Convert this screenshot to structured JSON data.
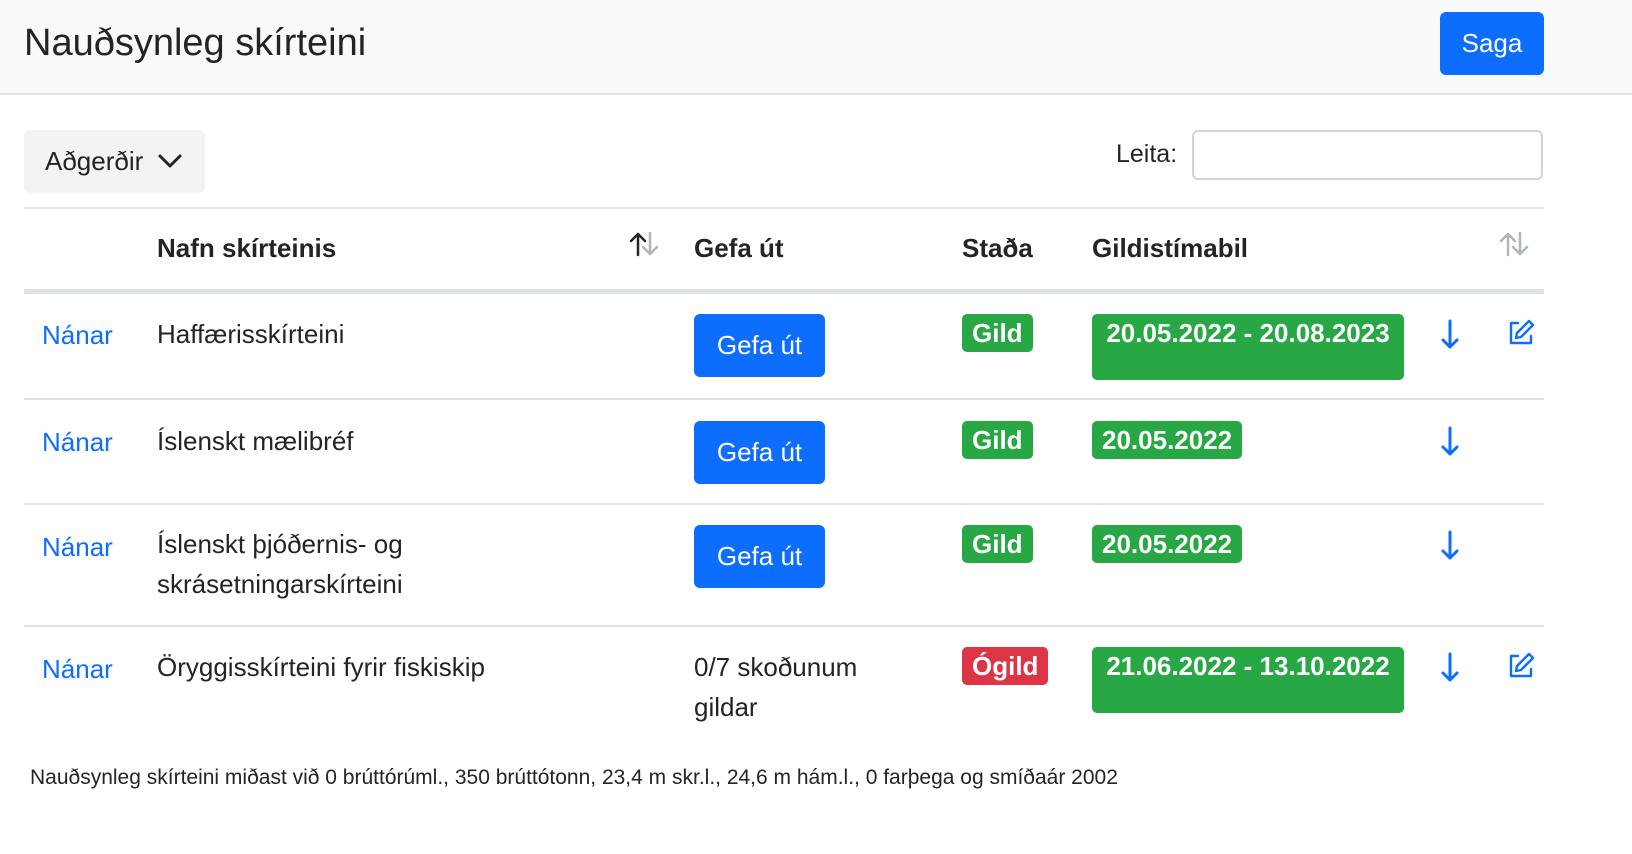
{
  "header": {
    "title": "Nauðsynleg skírteini",
    "history_button": "Saga"
  },
  "toolbar": {
    "actions_label": "Aðgerðir",
    "search_label": "Leita:",
    "search_value": "",
    "search_placeholder": ""
  },
  "table": {
    "columns": [
      "Nafn skírteinis",
      "Gefa út",
      "Staða",
      "Gildistímabil"
    ],
    "rows": [
      {
        "link": "Nánar",
        "name": "Haffærisskírteini",
        "issue_button": "Gefa út",
        "issue_text": "",
        "status": "Gild",
        "status_color": "#28a745",
        "period": "20.05.2022 - 20.08.2023",
        "period_color": "#28a745",
        "has_edit": true
      },
      {
        "link": "Nánar",
        "name": "Íslenskt mælibréf",
        "issue_button": "Gefa út",
        "issue_text": "",
        "status": "Gild",
        "status_color": "#28a745",
        "period": "20.05.2022",
        "period_color": "#28a745",
        "has_edit": false
      },
      {
        "link": "Nánar",
        "name": "Íslenskt þjóðernis- og skrásetningarskírteini",
        "issue_button": "Gefa út",
        "issue_text": "",
        "status": "Gild",
        "status_color": "#28a745",
        "period": "20.05.2022",
        "period_color": "#28a745",
        "has_edit": false
      },
      {
        "link": "Nánar",
        "name": "Öryggisskírteini fyrir fiskiskip",
        "issue_button": "",
        "issue_text": "0/7 skoðunum gildar",
        "status": "Ógild",
        "status_color": "#dc3545",
        "period": "21.06.2022 - 13.10.2022",
        "period_color": "#28a745",
        "has_edit": true
      }
    ]
  },
  "icons": {
    "sort": "sort-arrows-icon",
    "download": "arrow-down-icon",
    "edit": "edit-icon",
    "dropdown": "chevron-down-icon"
  },
  "colors": {
    "primary": "#0d6efd",
    "success": "#28a745",
    "danger": "#dc3545"
  },
  "footnote": "Nauðsynleg skírteini miðast við 0 brúttórúml., 350 brúttótonn, 23,4 m skr.l., 24,6 m hám.l., 0 farþega og smíðaár 2002"
}
